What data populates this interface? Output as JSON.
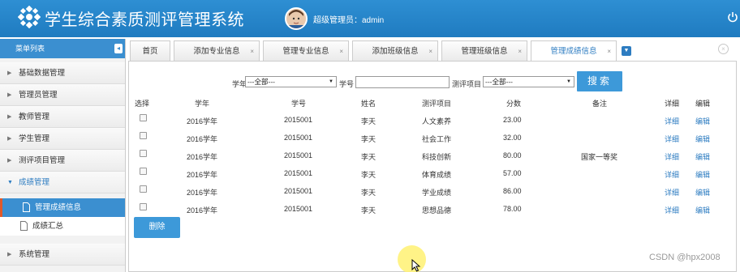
{
  "header": {
    "title": "学生综合素质测评管理系统",
    "user_label": "超级管理员：admin",
    "icons": [
      "flower-logo-icon",
      "avatar",
      "power-icon"
    ],
    "color": "#2584cb"
  },
  "sidebar": {
    "title": "菜单列表",
    "items": [
      {
        "label": "基础数据管理"
      },
      {
        "label": "管理员管理"
      },
      {
        "label": "教师管理"
      },
      {
        "label": "学生管理"
      },
      {
        "label": "测评项目管理"
      },
      {
        "label": "成绩管理"
      },
      {
        "label": "系统管理"
      }
    ],
    "sub_items": [
      {
        "label": "管理成绩信息"
      },
      {
        "label": "成绩汇总"
      }
    ]
  },
  "tabs": [
    {
      "label": "首页"
    },
    {
      "label": "添加专业信息"
    },
    {
      "label": "管理专业信息"
    },
    {
      "label": "添加班级信息"
    },
    {
      "label": "管理班级信息"
    },
    {
      "label": "管理成绩信息"
    }
  ],
  "filter": {
    "year_label": "学年",
    "year_value": "---全部---",
    "student_no_label": "学号",
    "student_no_value": "",
    "item_label": "测评项目",
    "item_value": "---全部---",
    "search_label": "搜索"
  },
  "table": {
    "columns": [
      "选择",
      "学年",
      "学号",
      "姓名",
      "测评项目",
      "分数",
      "备注",
      "详细",
      "编辑"
    ],
    "rows": [
      {
        "year": "2016学年",
        "no": "2015001",
        "name": "李天",
        "item": "人文素养",
        "score": "23.00",
        "note": "",
        "detail": "详细",
        "edit": "编辑"
      },
      {
        "year": "2016学年",
        "no": "2015001",
        "name": "李天",
        "item": "社会工作",
        "score": "32.00",
        "note": "",
        "detail": "详细",
        "edit": "编辑"
      },
      {
        "year": "2016学年",
        "no": "2015001",
        "name": "李天",
        "item": "科技创新",
        "score": "80.00",
        "note": "国家一等奖",
        "detail": "详细",
        "edit": "编辑"
      },
      {
        "year": "2016学年",
        "no": "2015001",
        "name": "李天",
        "item": "体育成绩",
        "score": "57.00",
        "note": "",
        "detail": "详细",
        "edit": "编辑"
      },
      {
        "year": "2016学年",
        "no": "2015001",
        "name": "李天",
        "item": "学业成绩",
        "score": "86.00",
        "note": "",
        "detail": "详细",
        "edit": "编辑"
      },
      {
        "year": "2016学年",
        "no": "2015001",
        "name": "李天",
        "item": "思想品德",
        "score": "78.00",
        "note": "",
        "detail": "详细",
        "edit": "编辑"
      }
    ],
    "delete_label": "删除"
  },
  "watermark": "CSDN @hpx2008"
}
